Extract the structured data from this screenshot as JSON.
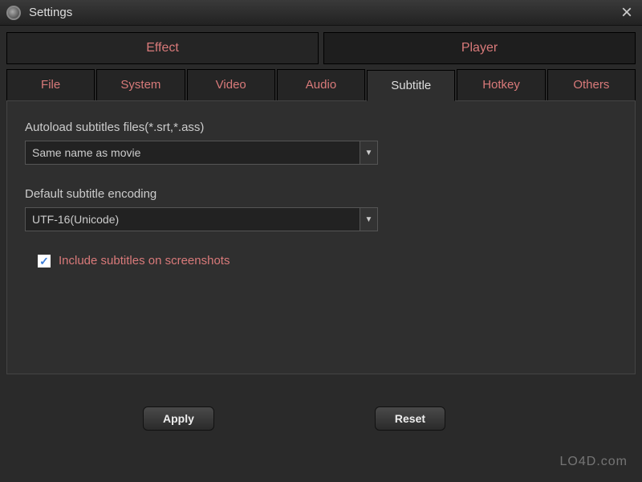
{
  "window": {
    "title": "Settings"
  },
  "primaryTabs": {
    "effect": "Effect",
    "player": "Player",
    "active": "player"
  },
  "subTabs": {
    "file": "File",
    "system": "System",
    "video": "Video",
    "audio": "Audio",
    "subtitle": "Subtitle",
    "hotkey": "Hotkey",
    "others": "Others",
    "active": "subtitle"
  },
  "form": {
    "autoload": {
      "label": "Autoload subtitles files(*.srt,*.ass)",
      "value": "Same name as movie"
    },
    "encoding": {
      "label": "Default subtitle encoding",
      "value": "UTF-16(Unicode)"
    },
    "includeSubs": {
      "label": "Include subtitles on screenshots",
      "checked": true
    }
  },
  "buttons": {
    "apply": "Apply",
    "reset": "Reset"
  },
  "watermark": "LO4D.com"
}
